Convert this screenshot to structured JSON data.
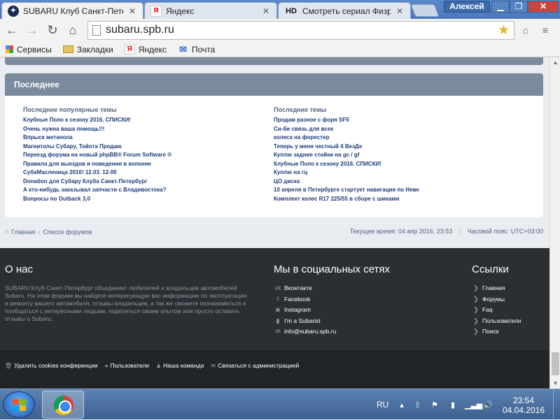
{
  "browser": {
    "tabs": [
      {
        "title": "SUBARU Клуб Санкт-Пете",
        "favicon": "subaru-icon",
        "active": true
      },
      {
        "title": "Яндекс",
        "favicon": "yandex-icon",
        "active": false
      },
      {
        "title": "Смотреть сериал Физрук",
        "favicon": "hd-icon",
        "badge": "HD",
        "active": false
      }
    ],
    "user_name": "Алексей",
    "url": "subaru.spb.ru",
    "bookmarks": [
      {
        "label": "Сервисы",
        "icon": "apps-icon"
      },
      {
        "label": "Закладки",
        "icon": "folder-icon"
      },
      {
        "label": "Яндекс",
        "icon": "yandex-icon"
      },
      {
        "label": "Почта",
        "icon": "mail-icon"
      }
    ],
    "yandex_letter": "Я"
  },
  "panel": {
    "title": "Последнее",
    "left_title": "Последние популярные темы",
    "left_items": [
      "Клубные Поло к сезону 2016. СПИСКИ!",
      "Очень нужна ваша помощь!!!",
      "Впрыск метанола",
      "Магнитолы Субару, Тойота Продаю",
      "Переезд форума на новый phpBB® Forum Software ®",
      "Правила для выездов и поведения в колонне",
      "СубаМасленица 2016! 12.03. 12-00",
      "Donation для Субару Клуба Санкт-Петербург",
      "А кто-нибудь заказывал запчасти с Владивостока?",
      "Вопросы по Outback 3,0"
    ],
    "right_title": "Последние темы",
    "right_items": [
      "Продам разное с форя SF5",
      "Си-би связь для всех",
      "колеса на форестер",
      "Теперь у меня честный 4 ВезДе",
      "Куплю задние стойки на gc / gf",
      "Клубные Поло к сезону 2016. СПИСКИ!",
      "Куплю на гц",
      "ЦО диска",
      "10 апреля в Петербурге стартует навигация по Неве",
      "Комплект колес R17 225/55 в сборе с шинами"
    ]
  },
  "breadcrumbs": {
    "home": "Главная",
    "forums": "Список форумов",
    "separator": "‹"
  },
  "timeinfo": {
    "current": "Текущее время: 04 апр 2016, 23:53",
    "divider": "|",
    "timezone": "Часовой пояс: UTC+03:00"
  },
  "footer": {
    "about_title": "О нас",
    "about_text": "SUBARU Клуб Санкт-Петербург объединяет любителей и владельцев автомобилей Subaru. На этом форуме вы найдете интересующую вас информацию по эксплуатации и ремонту вашего автомобиля, отзывы владельцев, а так же сможете познакомиться и пообщаться с интересными людьми, поделиться своим опытом или просто оставить отзывы о Subaru.",
    "social_title": "Мы в социальных сетях",
    "social_links": [
      {
        "label": "Вконтакте",
        "icon": "vk-icon",
        "glyph": "vk"
      },
      {
        "label": "Facebook",
        "icon": "facebook-icon",
        "glyph": "f"
      },
      {
        "label": "Instagram",
        "icon": "instagram-icon",
        "glyph": "◙"
      },
      {
        "label": "I'm a Subarist",
        "icon": "bookmark-icon",
        "glyph": "▮"
      },
      {
        "label": "info@subaru.spb.ru",
        "icon": "envelope-icon",
        "glyph": "✉"
      }
    ],
    "links_title": "Ссылки",
    "links": [
      "Главная",
      "Форумы",
      "Faq",
      "Пользователи",
      "Поиск"
    ],
    "bottom_links": [
      {
        "label": "Удалить cookies конференции",
        "icon": "trash-icon"
      },
      {
        "label": "Пользователи",
        "icon": "user-icon"
      },
      {
        "label": "Наша команда",
        "icon": "team-icon"
      },
      {
        "label": "Связаться с администрацией",
        "icon": "envelope-icon"
      }
    ]
  },
  "taskbar": {
    "language": "RU",
    "time": "23:54",
    "date": "04.04.2016"
  }
}
